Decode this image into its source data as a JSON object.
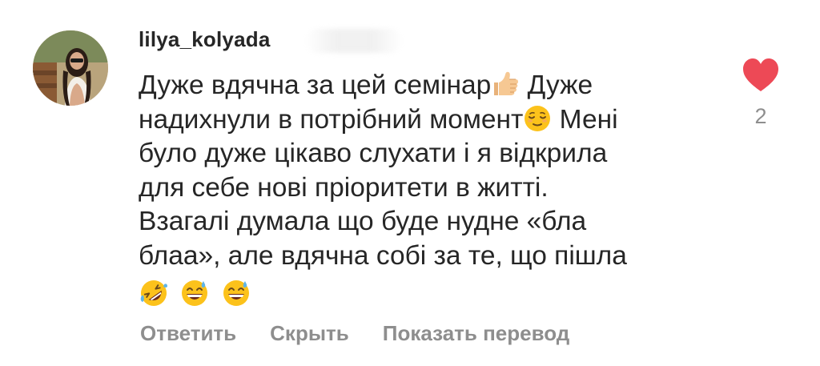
{
  "comment": {
    "username": "lilya_kolyada",
    "avatar": "avatar",
    "lines": [
      {
        "text": "Дуже вдячна за цей семінар",
        "emoji": "thumbs-up-icon",
        "tail": " Дуже"
      },
      {
        "text": "надихнули в потрібний момент",
        "emoji": "relieved-face-icon",
        "tail": " Мені"
      },
      {
        "text": "було дуже цікаво слухати і я відкрила"
      },
      {
        "text": "для себе нові пріоритети в житті."
      },
      {
        "text": "Взагалі думала що буде нудне «бла"
      },
      {
        "text": "блаа», але вдячна собі за те, що пішла"
      }
    ],
    "emoji_row": [
      "rolling-on-floor-laughing-icon",
      "grinning-sweat-icon",
      "grinning-sweat-icon"
    ],
    "like": {
      "icon": "heart-icon",
      "count": "2",
      "color": "#ed4956"
    }
  },
  "actions": {
    "reply": "Ответить",
    "hide": "Скрыть",
    "translate": "Показать перевод"
  },
  "colors": {
    "text": "#262626",
    "secondary": "#8e8e8e",
    "like": "#ed4956"
  }
}
